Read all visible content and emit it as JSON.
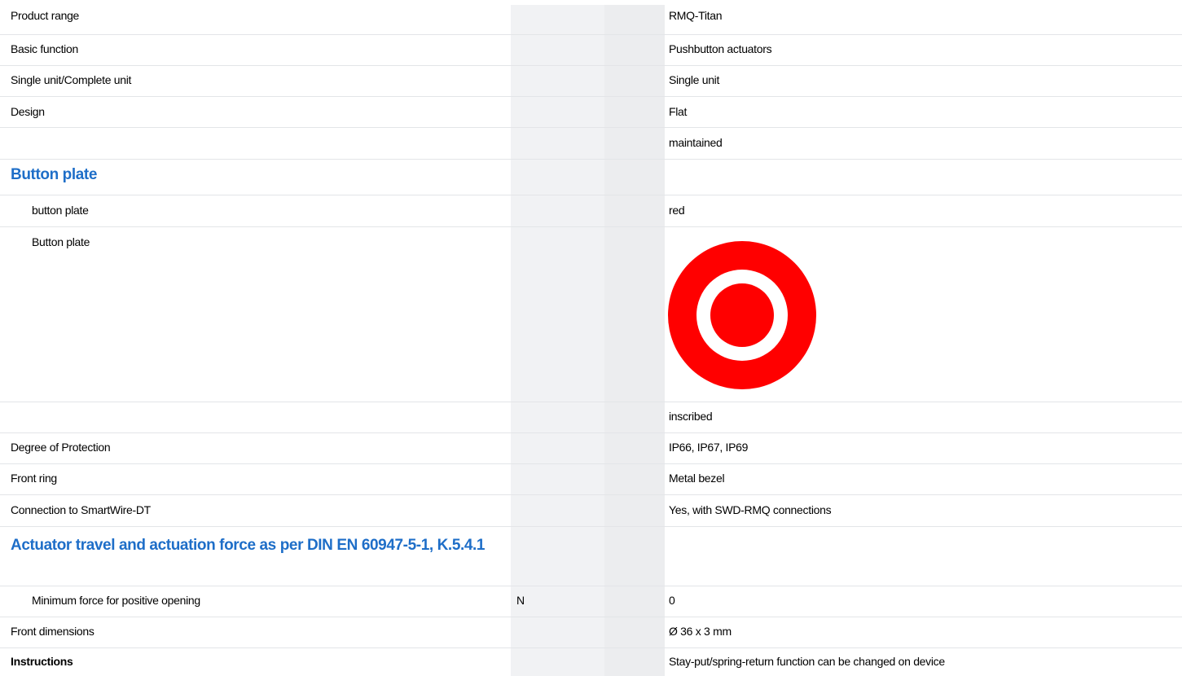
{
  "rows": {
    "product_range": {
      "label": "Product range",
      "value": "RMQ-Titan"
    },
    "basic_function": {
      "label": "Basic function",
      "value": "Pushbutton actuators"
    },
    "single_complete": {
      "label": "Single unit/Complete unit",
      "value": "Single unit"
    },
    "design": {
      "label": "Design",
      "value": "Flat"
    },
    "design_extra": {
      "label": "",
      "value": "maintained"
    },
    "button_plate_heading": "Button plate",
    "button_plate_color": {
      "label": "button plate",
      "value": "red"
    },
    "button_plate_image": {
      "label": "Button plate",
      "icon": "target-icon",
      "colors": {
        "outer": "#ff0000",
        "ring": "#ffffff",
        "center": "#ff0000"
      }
    },
    "inscription": {
      "label": "",
      "value": "inscribed"
    },
    "degree_protection": {
      "label": "Degree of Protection",
      "value": "IP66, IP67, IP69"
    },
    "front_ring": {
      "label": "Front ring",
      "value": "Metal bezel"
    },
    "smartwire": {
      "label": "Connection to SmartWire-DT",
      "value": "Yes, with SWD-RMQ connections"
    },
    "actuator_heading": "Actuator travel and actuation force as per DIN EN 60947-5-1, K.5.4.1",
    "min_force": {
      "label": "Minimum force for positive opening",
      "unit": "N",
      "value": "0"
    },
    "front_dimensions": {
      "label": "Front dimensions",
      "value": "Ø 36 x 3 mm"
    },
    "instructions": {
      "label": "Instructions",
      "value": "Stay-put/spring-return function can be changed on device"
    }
  },
  "colors": {
    "heading": "#1e6ec8",
    "stripe": "#f1f2f4",
    "divider": "#e3e5e8"
  }
}
